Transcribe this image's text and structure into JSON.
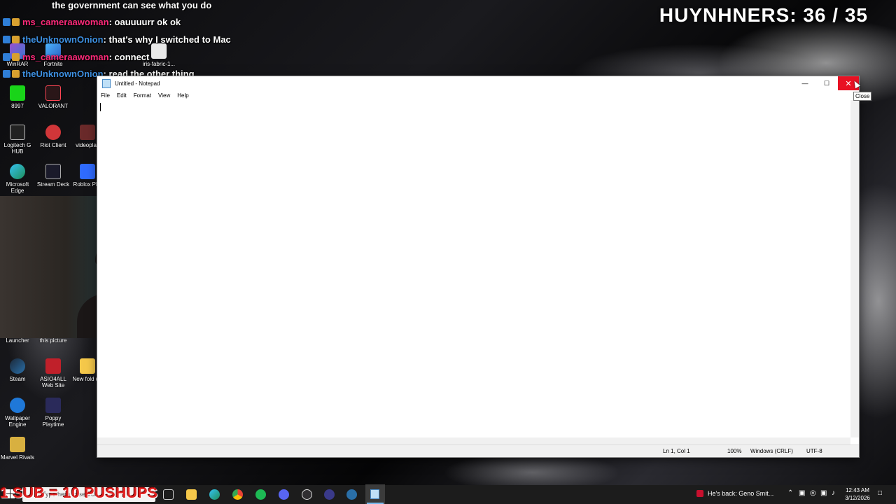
{
  "stream": {
    "counter": "HUYNHNERS: 36 / 35",
    "sub_banner": "1 SUB = 10 PUSHUPS"
  },
  "chat": [
    {
      "user": "",
      "message": "the government can see what you do",
      "user_color": "blue"
    },
    {
      "user": "ms_cameraawoman",
      "message": ": oauuuurr ok ok",
      "user_color": "pink"
    },
    {
      "user": "theUnknownOnion",
      "message": ": that's why I switched to Mac",
      "user_color": "blue"
    },
    {
      "user": "ms_cameraawoman",
      "message": ": connect",
      "user_color": "pink"
    },
    {
      "user": "theUnknownOnion",
      "message": ": read the other thing",
      "user_color": "blue"
    }
  ],
  "desktop_icons": [
    {
      "label": "WinRAR",
      "icon": "winrar-icon"
    },
    {
      "label": "Fortnite",
      "icon": "fortnite-icon"
    },
    {
      "label": "iris-fabric-1...",
      "icon": "java-icon"
    },
    {
      "label": "8997",
      "icon": "green-app-icon"
    },
    {
      "label": "VALORANT",
      "icon": "valorant-icon"
    },
    {
      "label": "Logitech G HUB",
      "icon": "logitech-icon"
    },
    {
      "label": "Riot Client",
      "icon": "riot-icon"
    },
    {
      "label": "videoplay",
      "icon": "video-icon"
    },
    {
      "label": "Microsoft Edge",
      "icon": "edge-icon"
    },
    {
      "label": "Stream Deck",
      "icon": "stream-deck-icon"
    },
    {
      "label": "Roblox Pl...",
      "icon": "roblox-icon"
    },
    {
      "label": "Launcher",
      "icon": "launcher-icon"
    },
    {
      "label": "this picture",
      "icon": "picture-icon"
    },
    {
      "label": "Steam",
      "icon": "steam-icon"
    },
    {
      "label": "ASIO4ALL Web Site",
      "icon": "asio-icon"
    },
    {
      "label": "New fold (2)",
      "icon": "folder-icon"
    },
    {
      "label": "Wallpaper Engine",
      "icon": "wallpaper-engine-icon"
    },
    {
      "label": "Poppy Playtime",
      "icon": "poppy-icon"
    },
    {
      "label": "Marvel Rivals",
      "icon": "marvel-icon"
    }
  ],
  "notepad": {
    "title": "Untitled - Notepad",
    "menu": [
      "File",
      "Edit",
      "Format",
      "View",
      "Help"
    ],
    "content": "",
    "status": {
      "position": "Ln 1, Col 1",
      "zoom": "100%",
      "line_ending": "Windows (CRLF)",
      "encoding": "UTF-8"
    },
    "close_tooltip": "Close"
  },
  "taskbar": {
    "search_placeholder": "Type here to search",
    "news": "He's back: Geno Smit...",
    "time": "12:43 AM",
    "date": "3/12/2026"
  },
  "colors": {
    "close_red": "#e81123",
    "chat_user_blue": "#3d8fe0",
    "chat_user_pink": "#ff2a7a",
    "sub_banner_red": "#e02020"
  }
}
